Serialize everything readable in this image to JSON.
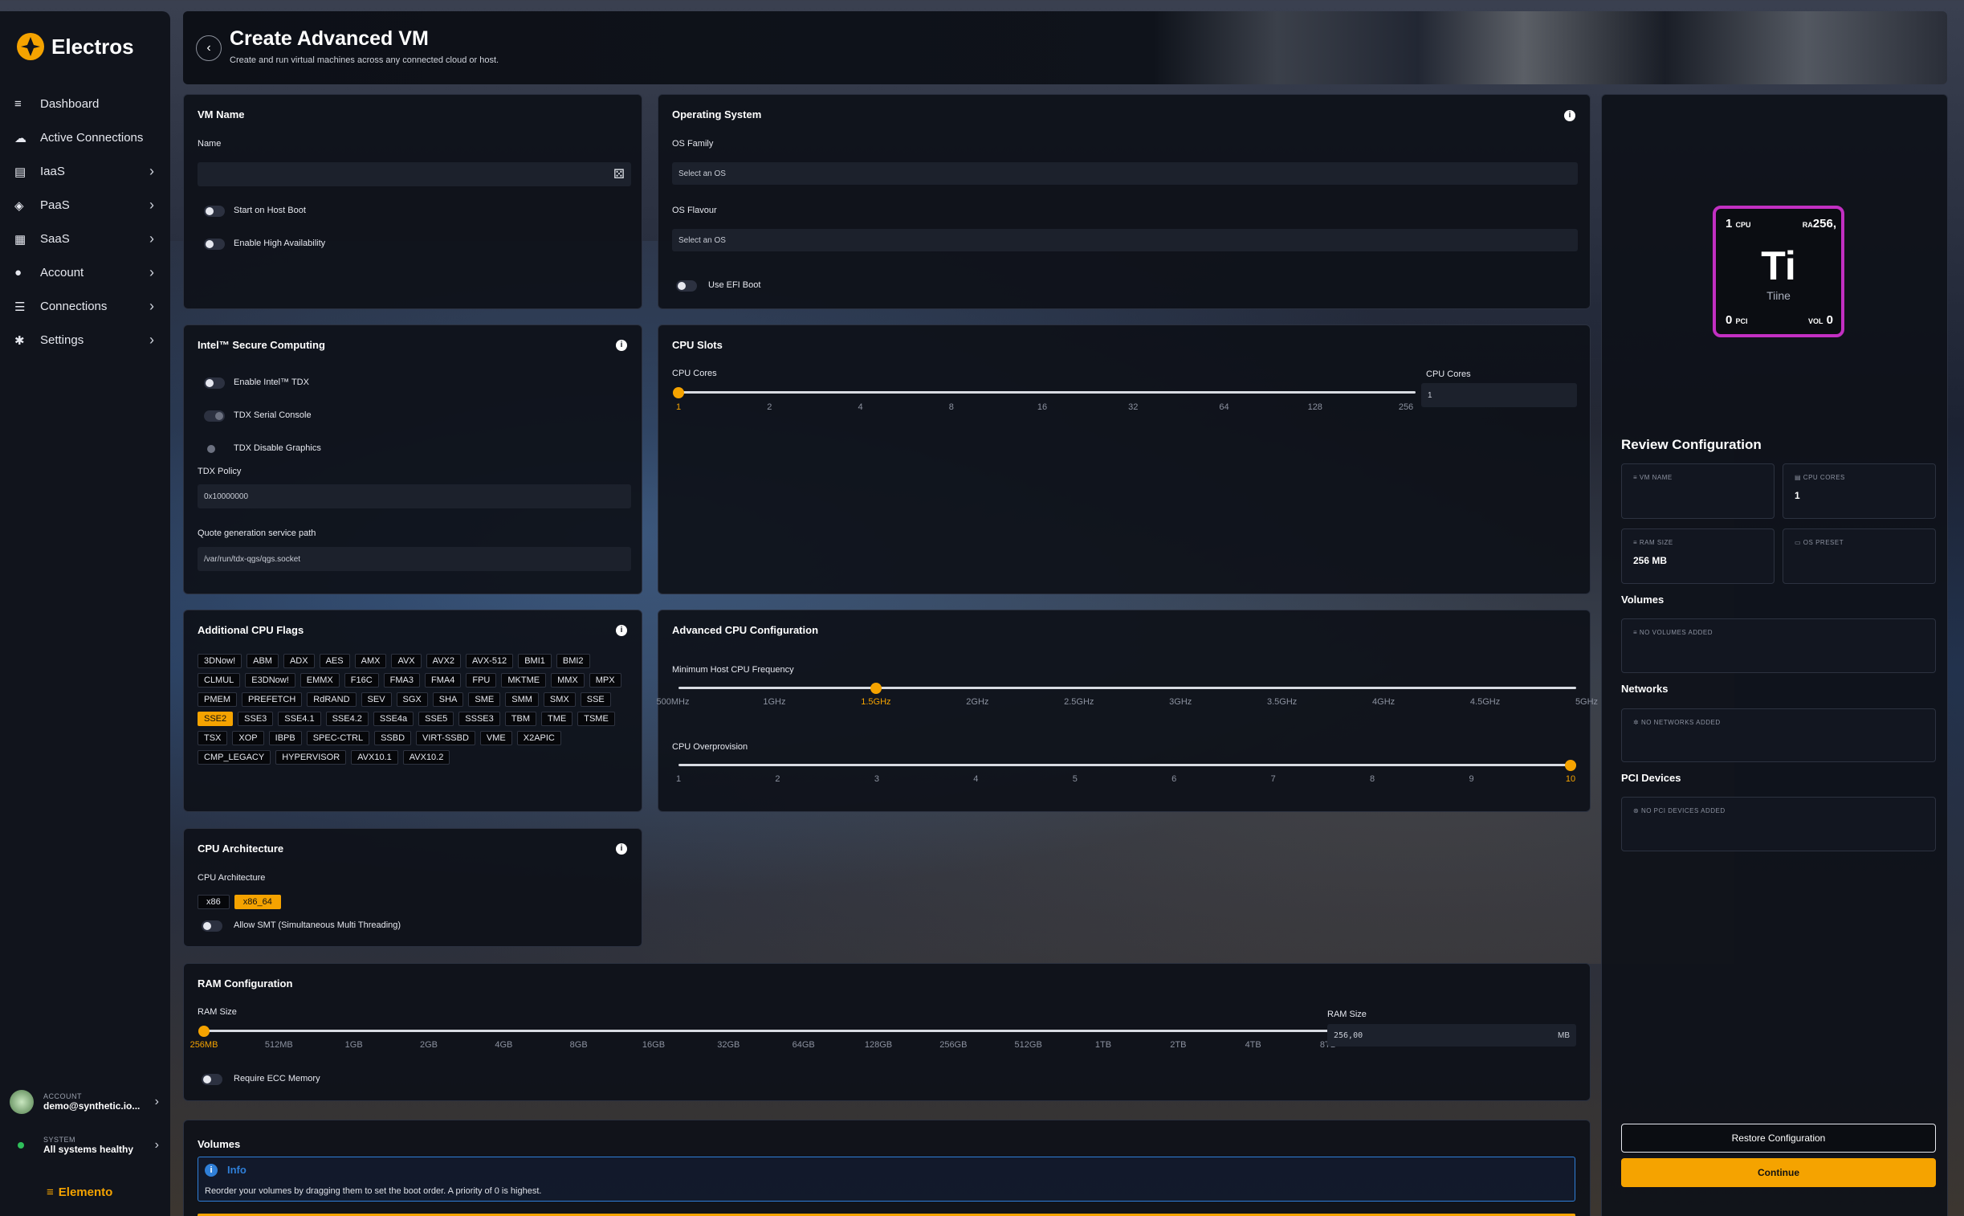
{
  "brand": {
    "name": "Electros",
    "footer": "Elemento"
  },
  "nav": [
    {
      "label": "Dashboard",
      "icon": "dashboard-icon",
      "chev": false
    },
    {
      "label": "Active Connections",
      "icon": "cloud-icon",
      "chev": false
    },
    {
      "label": "IaaS",
      "icon": "server-icon",
      "chev": true
    },
    {
      "label": "PaaS",
      "icon": "cubes-icon",
      "chev": true
    },
    {
      "label": "SaaS",
      "icon": "grid-icon",
      "chev": true
    },
    {
      "label": "Account",
      "icon": "user-icon",
      "chev": true
    },
    {
      "label": "Connections",
      "icon": "connections-icon",
      "chev": true
    },
    {
      "label": "Settings",
      "icon": "gear-icon",
      "chev": true
    }
  ],
  "account": {
    "label": "ACCOUNT",
    "value": "demo@synthetic.io..."
  },
  "system": {
    "label": "SYSTEM",
    "value": "All systems healthy"
  },
  "header": {
    "title": "Create Advanced VM",
    "subtitle": "Create and run virtual machines across any connected cloud or host."
  },
  "vmname": {
    "title": "VM Name",
    "name_label": "Name",
    "name_value": "",
    "start_on_boot": "Start on Host Boot",
    "high_avail": "Enable High Availability"
  },
  "os": {
    "title": "Operating System",
    "family_label": "OS Family",
    "family_value": "Select an OS",
    "flavour_label": "OS Flavour",
    "flavour_value": "Select an OS",
    "efi": "Use EFI Boot"
  },
  "intel": {
    "title": "Intel™ Secure Computing",
    "tdx": "Enable Intel™ TDX",
    "serial": "TDX Serial Console",
    "graphics": "TDX Disable Graphics",
    "policy_label": "TDX Policy",
    "policy_value": "0x10000000",
    "quote_label": "Quote generation service path",
    "quote_value": "/var/run/tdx-qgs/qgs.socket"
  },
  "cpuslots": {
    "title": "CPU Slots",
    "label": "CPU Cores",
    "ticks": [
      "1",
      "2",
      "4",
      "8",
      "16",
      "32",
      "64",
      "128",
      "256"
    ],
    "selected": "1",
    "input_label": "CPU Cores",
    "input_value": "1"
  },
  "flags": {
    "title": "Additional CPU Flags",
    "items": [
      "3DNow!",
      "ABM",
      "ADX",
      "AES",
      "AMX",
      "AVX",
      "AVX2",
      "AVX-512",
      "BMI1",
      "BMI2",
      "CLMUL",
      "E3DNow!",
      "EMMX",
      "F16C",
      "FMA3",
      "FMA4",
      "FPU",
      "MKTME",
      "MMX",
      "MPX",
      "PMEM",
      "PREFETCH",
      "RdRAND",
      "SEV",
      "SGX",
      "SHA",
      "SME",
      "SMM",
      "SMX",
      "SSE",
      "SSE2",
      "SSE3",
      "SSE4.1",
      "SSE4.2",
      "SSE4a",
      "SSE5",
      "SSSE3",
      "TBM",
      "TME",
      "TSME",
      "TSX",
      "XOP",
      "IBPB",
      "SPEC-CTRL",
      "SSBD",
      "VIRT-SSBD",
      "VME",
      "X2APIC",
      "CMP_LEGACY",
      "HYPERVISOR",
      "AVX10.1",
      "AVX10.2"
    ],
    "selected": "SSE2"
  },
  "advcpu": {
    "title": "Advanced CPU Configuration",
    "freq_label": "Minimum Host CPU Frequency",
    "freq_ticks": [
      "500MHz",
      "1GHz",
      "1.5GHz",
      "2GHz",
      "2.5GHz",
      "3GHz",
      "3.5GHz",
      "4GHz",
      "4.5GHz",
      "5GHz"
    ],
    "freq_selected": "1.5GHz",
    "over_label": "CPU Overprovision",
    "over_ticks": [
      "1",
      "2",
      "3",
      "4",
      "5",
      "6",
      "7",
      "8",
      "9",
      "10"
    ],
    "over_selected": "10"
  },
  "arch": {
    "title": "CPU Architecture",
    "label": "CPU Architecture",
    "options": [
      "x86",
      "x86_64"
    ],
    "selected": "x86_64",
    "smt": "Allow SMT (Simultaneous Multi Threading)"
  },
  "ram": {
    "title": "RAM Configuration",
    "label": "RAM Size",
    "ticks": [
      "256MB",
      "512MB",
      "1GB",
      "2GB",
      "4GB",
      "8GB",
      "16GB",
      "32GB",
      "64GB",
      "128GB",
      "256GB",
      "512GB",
      "1TB",
      "2TB",
      "4TB",
      "8TB"
    ],
    "selected": "256MB",
    "input_label": "RAM Size",
    "input_value": "256,00",
    "unit": "MB",
    "ecc": "Require ECC Memory"
  },
  "volumes": {
    "title": "Volumes",
    "info_title": "Info",
    "info_text": "Reorder your volumes by dragging them to set the boot order. A priority of 0 is highest."
  },
  "element": {
    "cpu_num": "1",
    "cpu_lbl": "CPU",
    "ram_lbl": "RA",
    "ram_val": "256,",
    "symbol": "Ti",
    "name": "Tiine",
    "pci_num": "0",
    "pci_lbl": "PCI",
    "vol_lbl": "VOL",
    "vol_num": "0",
    "color": "#c22fc2"
  },
  "review": {
    "title": "Review Configuration",
    "vm_name_lbl": "VM NAME",
    "vm_name_val": "",
    "cpu_lbl": "CPU CORES",
    "cpu_val": "1",
    "ram_lbl": "RAM SIZE",
    "ram_val": "256 MB",
    "os_lbl": "OS PRESET",
    "os_val": "",
    "volumes": "Volumes",
    "no_volumes": "NO VOLUMES ADDED",
    "networks": "Networks",
    "no_networks": "NO NETWORKS ADDED",
    "pci": "PCI Devices",
    "no_pci": "NO PCI DEVICES ADDED",
    "restore": "Restore Configuration",
    "continue": "Continue"
  },
  "colors": {
    "accent": "#f5a300",
    "panel": "#0e1119",
    "element_border": "#c22fc2",
    "info_blue": "#2f7fd8"
  }
}
